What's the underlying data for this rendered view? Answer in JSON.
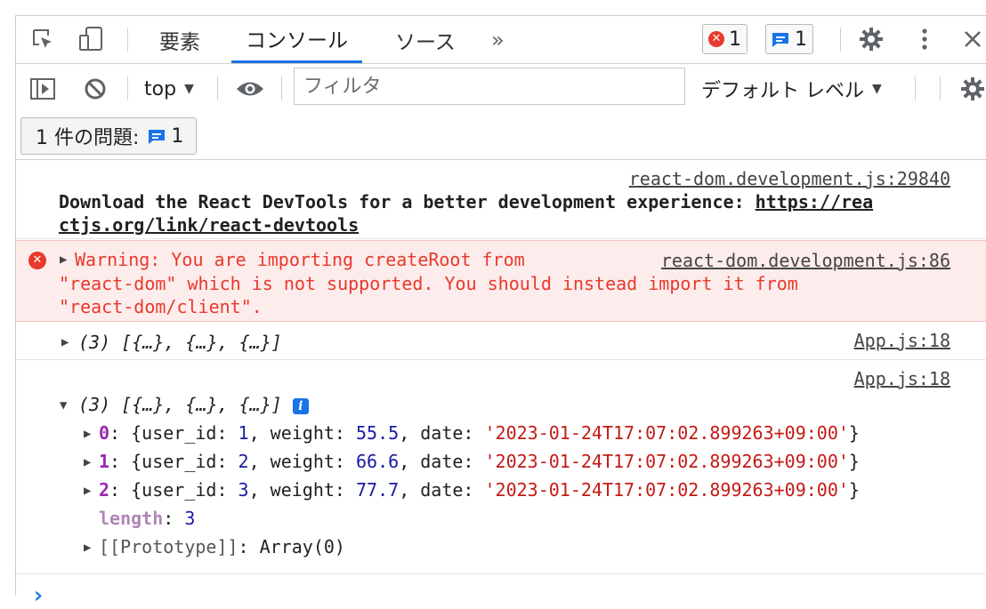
{
  "tabs": [
    "要素",
    "コンソール",
    "ソース"
  ],
  "more_tabs_glyph": "»",
  "error_badge_count": "1",
  "message_badge_count": "1",
  "context_label": "top",
  "filter_placeholder": "フィルタ",
  "level_label": "デフォルト レベル",
  "issues_label": "1 件の問題:",
  "issues_count": "1",
  "colors": {
    "accent": "#1a73e8",
    "error": "#e8392c",
    "error_bg": "#fdecec",
    "number": "#1a1aa6",
    "string": "#c41a16"
  },
  "console": {
    "msg1": {
      "source": "react-dom.development.js:29840",
      "text": "Download the React DevTools for a better development experience: ",
      "link_part1": "https://rea",
      "link_part2": "ctjs.org/link/react-devtools"
    },
    "msg2": {
      "source": "react-dom.development.js:86",
      "line1": "Warning: You are importing createRoot from",
      "line2": "\"react-dom\" which is not supported. You should instead import it from",
      "line3": "\"react-dom/client\"."
    },
    "msg3": {
      "source": "App.js:18",
      "summary": "(3) [{…}, {…}, {…}]"
    },
    "msg4": {
      "source": "App.js:18",
      "summary": "(3) [{…}, {…}, {…}]",
      "items": [
        {
          "index": "0",
          "user_id": "1",
          "weight": "55.5",
          "date": "'2023-01-24T17:07:02.899263+09:00'"
        },
        {
          "index": "1",
          "user_id": "2",
          "weight": "66.6",
          "date": "'2023-01-24T17:07:02.899263+09:00'"
        },
        {
          "index": "2",
          "user_id": "3",
          "weight": "77.7",
          "date": "'2023-01-24T17:07:02.899263+09:00'"
        }
      ],
      "length_key": "length",
      "length_value": "3",
      "prototype": "[[Prototype]]",
      "prototype_value": "Array(0)"
    },
    "prompt_glyph": "›"
  }
}
